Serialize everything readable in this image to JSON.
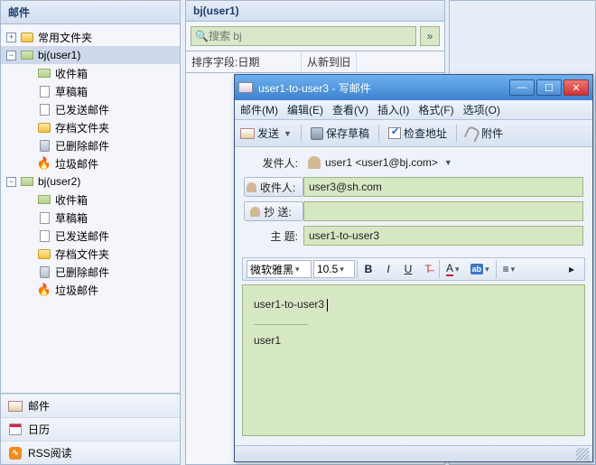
{
  "left": {
    "header": "邮件",
    "tree": {
      "favorites": "常用文件夹",
      "account1": "bj(user1)",
      "account2": "bj(user2)",
      "inbox": "收件箱",
      "drafts": "草稿箱",
      "sent": "已发送邮件",
      "archive": "存档文件夹",
      "deleted": "已删除邮件",
      "junk": "垃圾邮件"
    },
    "nav": {
      "mail": "邮件",
      "calendar": "日历",
      "rss": "RSS阅读"
    }
  },
  "mid": {
    "header": "bj(user1)",
    "search_placeholder": "搜索 bj",
    "sort_label": "排序字段:日期",
    "sort_dir": "从新到旧"
  },
  "compose": {
    "title": "user1-to-user3 - 写邮件",
    "menu": {
      "mail": "邮件(M)",
      "edit": "编辑(E)",
      "view": "查看(V)",
      "insert": "插入(I)",
      "format": "格式(F)",
      "options": "选项(O)"
    },
    "toolbar": {
      "send": "发送",
      "save_draft": "保存草稿",
      "check_addr": "检查地址",
      "attach": "附件"
    },
    "fields": {
      "from_label": "发件人:",
      "from_value": "user1 <user1@bj.com>",
      "to_label": "收件人:",
      "to_value": "user3@sh.com",
      "cc_label": "抄  送:",
      "cc_value": "",
      "subject_label": "主  题:",
      "subject_value": "user1-to-user3"
    },
    "format": {
      "font": "微软雅黑",
      "size": "10.5"
    },
    "body_line1": "user1-to-user3",
    "signature": "user1"
  },
  "chart_data": null
}
